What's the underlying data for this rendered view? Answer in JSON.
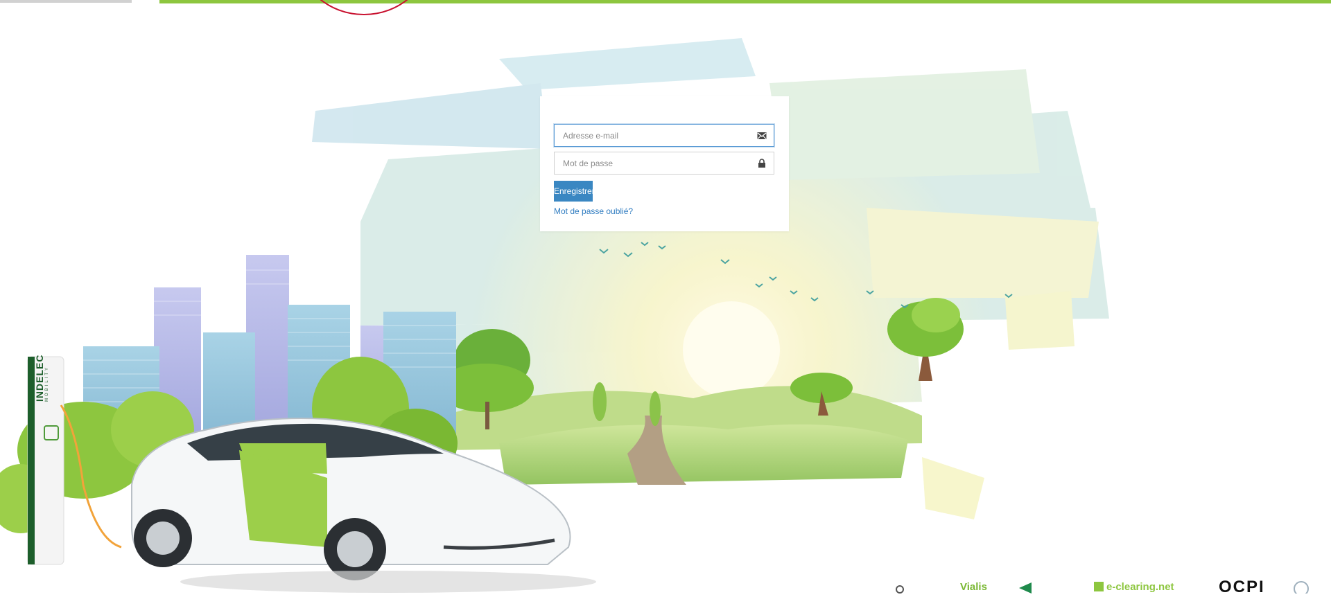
{
  "login": {
    "email_placeholder": "Adresse e-mail",
    "password_placeholder": "Mot de passe",
    "submit_label": "Enregistrer",
    "forgot_link": "Mot de passe oublié?"
  },
  "charger": {
    "brand": "INDELEC",
    "subbrand": "MOBILITY"
  },
  "footer": {
    "partner_1": "Vialis",
    "partner_2": "e-clearing.net",
    "partner_3": "OCPI"
  },
  "colors": {
    "accent_green": "#8dc63f",
    "button_blue": "#3a87c2",
    "link_blue": "#2e7bc0"
  }
}
